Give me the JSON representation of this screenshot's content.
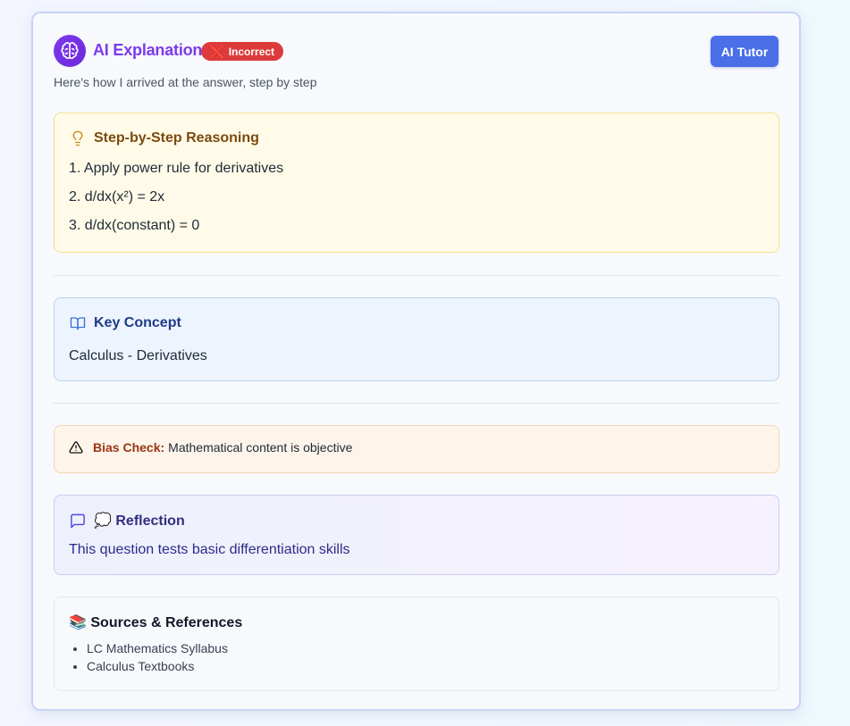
{
  "header": {
    "title": "AI Explanation",
    "badge": "Incorrect",
    "badge_icon": "❌",
    "tutor_button": "AI Tutor",
    "subtitle": "Here's how I arrived at the answer, step by step"
  },
  "reasoning": {
    "heading": "Step-by-Step Reasoning",
    "steps": [
      "1. Apply power rule for derivatives",
      "2. d/dx(x²) = 2x",
      "3. d/dx(constant) = 0"
    ]
  },
  "key_concept": {
    "heading": "Key Concept",
    "text": "Calculus - Derivatives"
  },
  "bias_check": {
    "label": "Bias Check:",
    "text": "Mathematical content is objective"
  },
  "reflection": {
    "heading": "💭 Reflection",
    "text": "This question tests basic differentiation skills"
  },
  "sources": {
    "heading": "📚 Sources & References",
    "items": [
      "LC Mathematics Syllabus",
      "Calculus Textbooks"
    ]
  },
  "colors": {
    "accent": "#7c3aed",
    "button": "#4a6fe6",
    "badge": "#dc3b3b"
  }
}
